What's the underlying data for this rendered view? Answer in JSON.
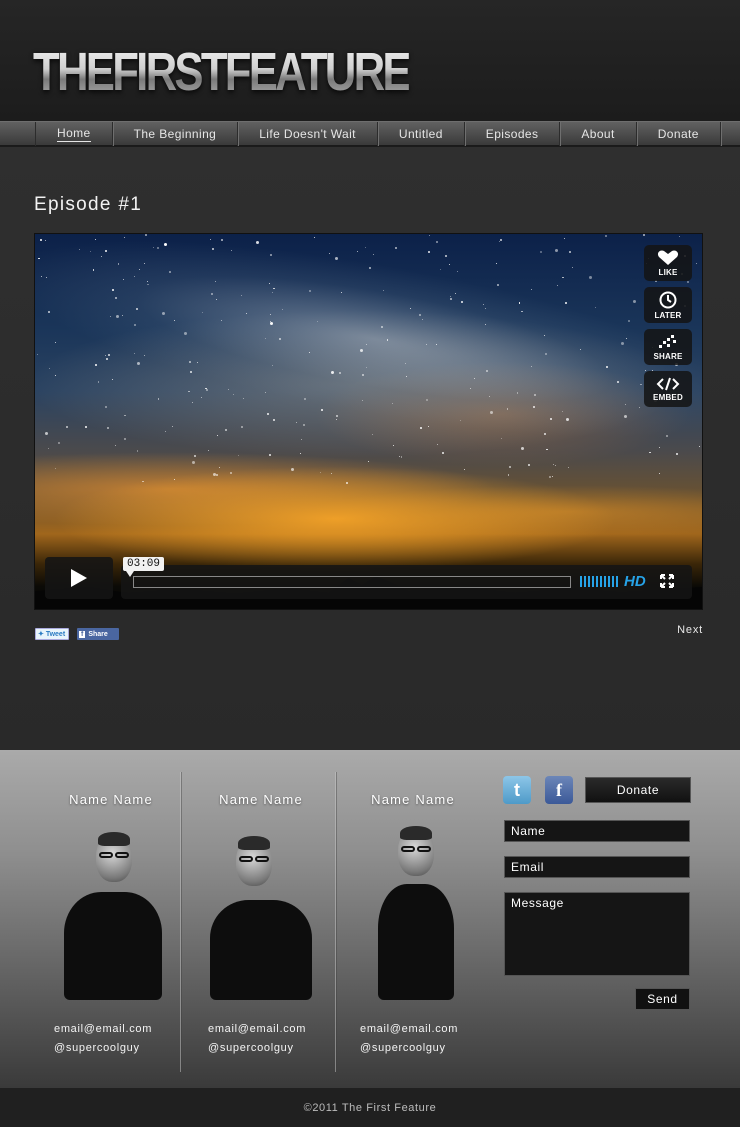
{
  "site": {
    "logo": "THEFIRSTFEATURE"
  },
  "nav": {
    "items": [
      {
        "label": "Home",
        "active": true
      },
      {
        "label": "The Beginning"
      },
      {
        "label": "Life Doesn't Wait"
      },
      {
        "label": "Untitled"
      },
      {
        "label": "Episodes"
      },
      {
        "label": "About"
      },
      {
        "label": "Donate"
      }
    ]
  },
  "episode": {
    "title": "Episode #1"
  },
  "video": {
    "actions": {
      "like": "LIKE",
      "later": "LATER",
      "share": "SHARE",
      "embed": "EMBED"
    },
    "time": "03:09",
    "quality": "HD",
    "accent": "#26a3e8"
  },
  "social": {
    "tweet": "Tweet",
    "share": "Share",
    "next": "Next"
  },
  "team": [
    {
      "name": "Name Name",
      "email": "email@email.com",
      "handle": "@supercoolguy"
    },
    {
      "name": "Name Name",
      "email": "email@email.com",
      "handle": "@supercoolguy"
    },
    {
      "name": "Name Name",
      "email": "email@email.com",
      "handle": "@supercoolguy"
    }
  ],
  "contact": {
    "donate": "Donate",
    "name_placeholder": "Name",
    "email_placeholder": "Email",
    "message_placeholder": "Message",
    "send": "Send"
  },
  "footer": {
    "copyright": "©2011 The First Feature"
  }
}
